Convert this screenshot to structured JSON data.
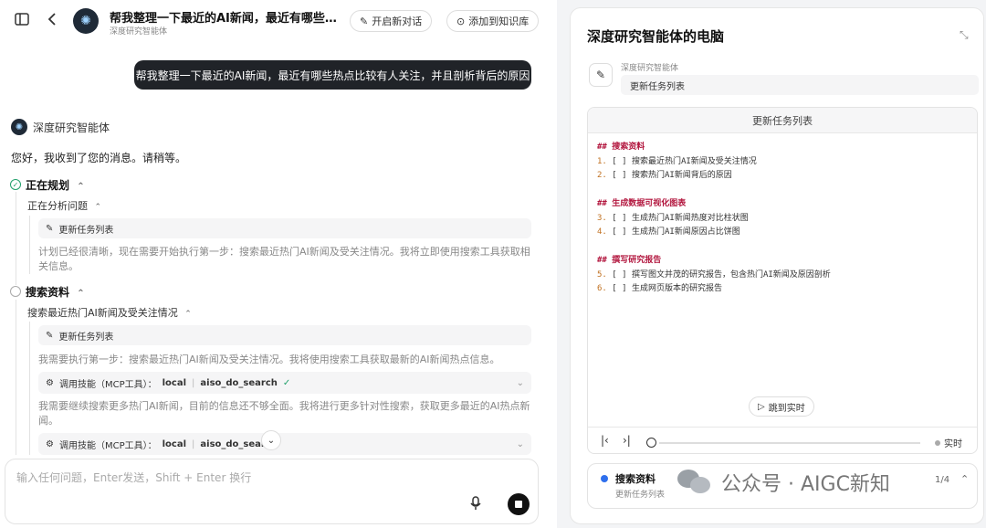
{
  "header": {
    "title": "帮我整理一下最近的AI新闻，最近有哪些热点比较有人关注，并且剖析背后的原因",
    "subtitle": "深度研究智能体",
    "new_chat": "开启新对话",
    "add_kb": "添加到知识库"
  },
  "user_message": "帮我整理一下最近的AI新闻，最近有哪些热点比较有人关注，并且剖析背后的原因",
  "agent": {
    "name": "深度研究智能体",
    "greeting": "您好，我收到了您的消息。请稍等。"
  },
  "steps": {
    "planning": {
      "title": "正在规划",
      "sub_title": "正在分析问题",
      "chip": "更新任务列表",
      "text": "计划已经很清晰，现在需要开始执行第一步：搜索最近热门AI新闻及受关注情况。我将立即使用搜索工具获取相关信息。"
    },
    "search": {
      "title": "搜索资料",
      "sub_title": "搜索最近热门AI新闻及受关注情况",
      "chip": "更新任务列表",
      "text1": "我需要执行第一步：搜索最近热门AI新闻及受关注情况。我将使用搜索工具获取最新的AI新闻热点信息。",
      "tool_label": "调用技能（MCP工具）：",
      "tool_scope": "local",
      "tool_name": "aiso_do_search",
      "text2": "我需要继续搜索更多热门AI新闻，目前的信息还不够全面。我将进行更多针对性搜索，获取更多最近的AI热点新闻。"
    }
  },
  "composer": {
    "placeholder": "输入任何问题，Enter发送，Shift + Enter 换行"
  },
  "right_panel": {
    "title": "深度研究智能体的电脑",
    "agent_label": "深度研究智能体",
    "action": "更新任务列表",
    "viewer_title": "更新任务列表",
    "markdown": [
      {
        "type": "h",
        "text": "## 搜索资料"
      },
      {
        "type": "item",
        "num": "1.",
        "text": "[ ] 搜索最近热门AI新闻及受关注情况"
      },
      {
        "type": "item",
        "num": "2.",
        "text": "[ ] 搜索热门AI新闻背后的原因"
      },
      {
        "type": "gap"
      },
      {
        "type": "h",
        "text": "## 生成数据可视化图表"
      },
      {
        "type": "item",
        "num": "3.",
        "text": "[ ] 生成热门AI新闻热度对比柱状图"
      },
      {
        "type": "item",
        "num": "4.",
        "text": "[ ] 生成热门AI新闻原因占比饼图"
      },
      {
        "type": "gap"
      },
      {
        "type": "h",
        "text": "## 撰写研究报告"
      },
      {
        "type": "item",
        "num": "5.",
        "text": "[ ] 撰写图文并茂的研究报告，包含热门AI新闻及原因剖析"
      },
      {
        "type": "item",
        "num": "6.",
        "text": "[ ] 生成网页版本的研究报告"
      }
    ],
    "jump_label": "跳到实时",
    "live_label": "实时",
    "task_title": "搜索资料",
    "task_sub": "更新任务列表",
    "task_count": "1/4"
  },
  "watermark": "公众号 · AIGC新知"
}
